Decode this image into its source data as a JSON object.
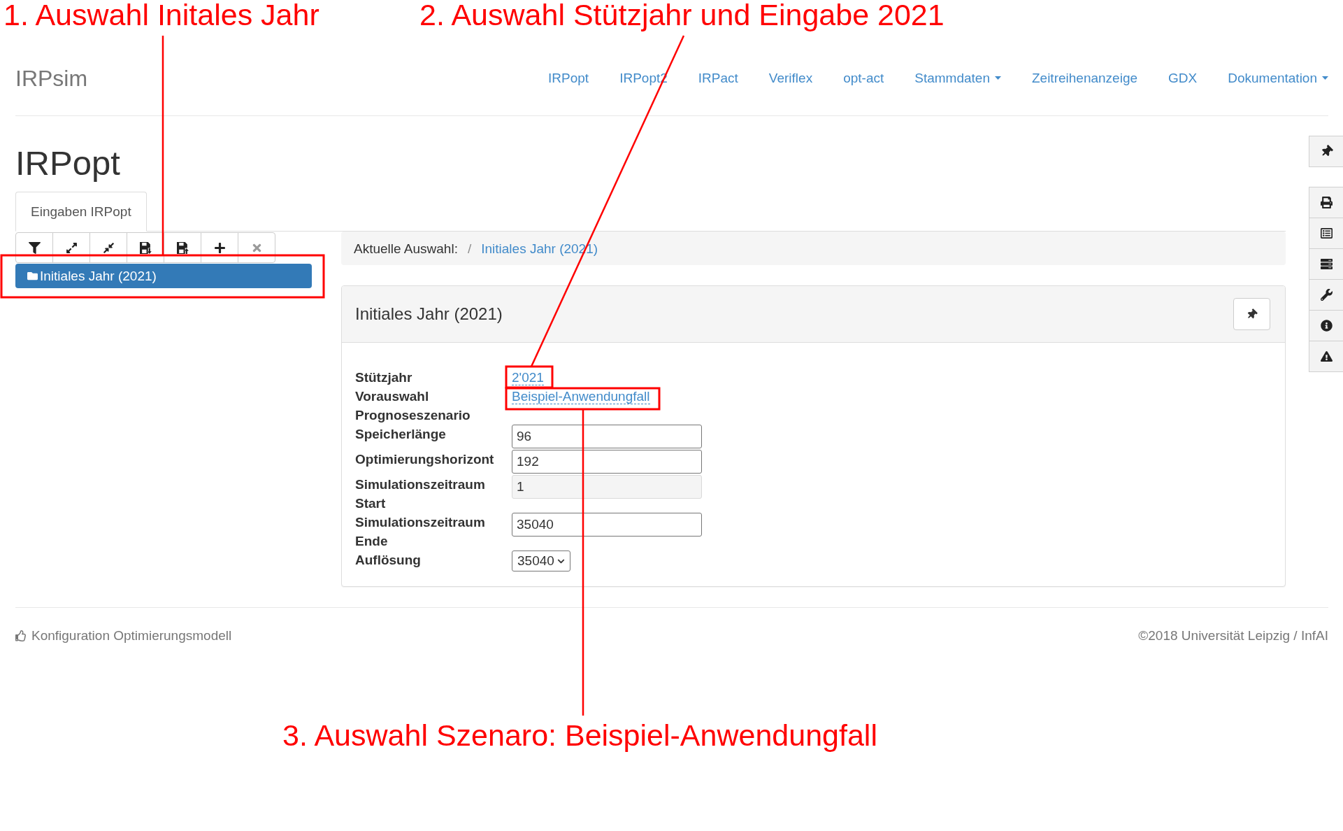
{
  "annotations": [
    {
      "text": "1. Auswahl Initales Jahr"
    },
    {
      "text": "2. Auswahl Stützjahr und Eingabe 2021"
    },
    {
      "text": "3. Auswahl Szenaro: Beispiel-Anwendungfall"
    }
  ],
  "navbar": {
    "brand": "IRPsim",
    "links": [
      {
        "label": "IRPopt",
        "dropdown": false
      },
      {
        "label": "IRPopt2",
        "dropdown": false
      },
      {
        "label": "IRPact",
        "dropdown": false
      },
      {
        "label": "Veriflex",
        "dropdown": false
      },
      {
        "label": "opt-act",
        "dropdown": false
      },
      {
        "label": "Stammdaten",
        "dropdown": true
      },
      {
        "label": "Zeitreihenanzeige",
        "dropdown": false
      },
      {
        "label": "GDX",
        "dropdown": false
      },
      {
        "label": "Dokumentation",
        "dropdown": true
      }
    ]
  },
  "page_title": "IRPopt",
  "tabs": [
    {
      "label": "Eingaben IRPopt",
      "selected": true
    }
  ],
  "tree_toolbar": {
    "buttons": [
      {
        "disabled": false
      },
      {
        "disabled": false
      },
      {
        "disabled": false
      },
      {
        "disabled": false
      },
      {
        "disabled": false
      },
      {
        "disabled": false
      },
      {
        "disabled": true
      }
    ]
  },
  "tree": {
    "nodes": [
      {
        "label": "Initiales Jahr (2021)",
        "selected": true
      }
    ]
  },
  "breadcrumb": {
    "label": "Aktuelle Auswahl:",
    "separator": "/",
    "items": [
      {
        "label": "Initiales Jahr (2021)"
      }
    ]
  },
  "panel": {
    "title": "Initiales Jahr (2021)",
    "fields": [
      {
        "label": "Stützjahr",
        "kind": "editable",
        "value": "2'021",
        "disabled": false
      },
      {
        "label": "Vorauswahl Prognoseszenario",
        "kind": "editable",
        "value": "Beispiel-Anwendungfall",
        "disabled": false
      },
      {
        "label": "Speicherlänge",
        "kind": "input",
        "value": "96",
        "disabled": false
      },
      {
        "label": "Optimierungshorizont",
        "kind": "input",
        "value": "192",
        "disabled": false
      },
      {
        "label": "Simulationszeitraum Start",
        "kind": "input",
        "value": "1",
        "disabled": true
      },
      {
        "label": "Simulationszeitraum Ende",
        "kind": "input",
        "value": "35040",
        "disabled": false
      },
      {
        "label": "Auflösung",
        "kind": "select",
        "value": "35040",
        "disabled": false
      }
    ]
  },
  "footer": {
    "left": "Konfiguration Optimierungsmodell",
    "right": "©2018 Universität Leipzig / InfAI"
  }
}
